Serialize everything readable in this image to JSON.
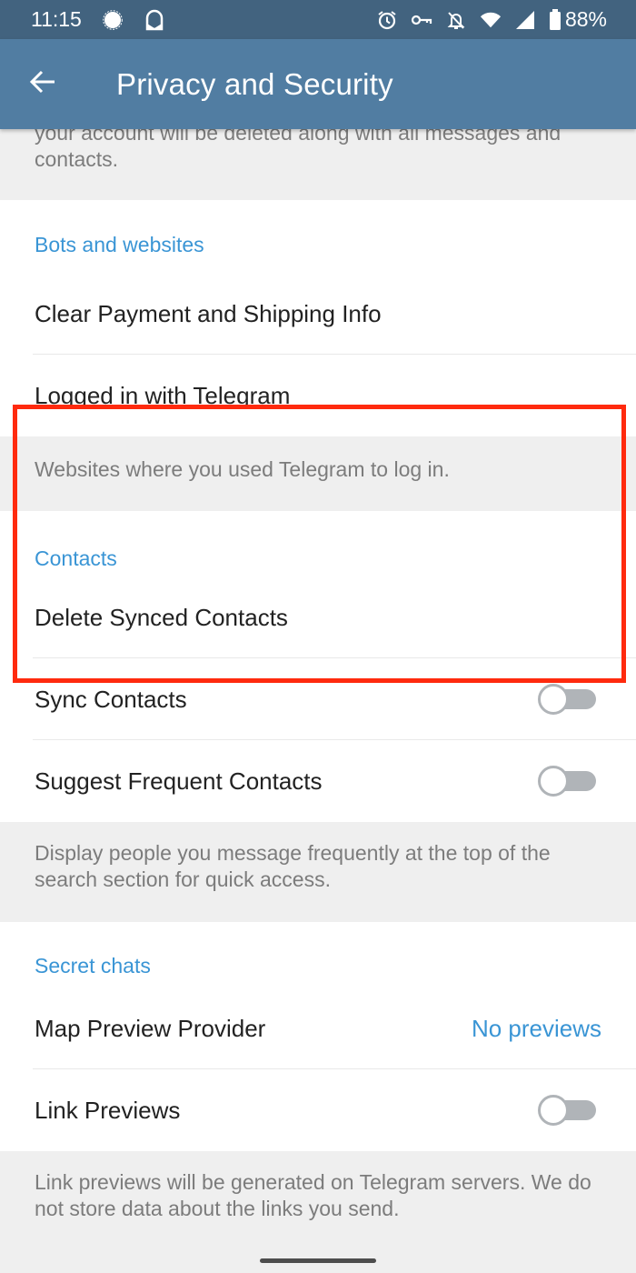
{
  "status_bar": {
    "time": "11:15",
    "left_icons": [
      "signal-messenger-icon",
      "protonmail-icon"
    ],
    "right_icons": [
      "alarm-icon",
      "vpn-key-icon",
      "notifications-off-icon",
      "wifi-icon",
      "cellular-signal-icon",
      "battery-icon"
    ],
    "battery": "88%"
  },
  "app_bar": {
    "back_icon": "arrow-back-icon",
    "title": "Privacy and Security"
  },
  "top_info": {
    "text_line1": "your account will be deleted along with all messages and",
    "text_line2": "contacts."
  },
  "sections": {
    "bots": {
      "header": "Bots and websites",
      "items": [
        {
          "label": "Clear Payment and Shipping Info"
        },
        {
          "label": "Logged in with Telegram"
        }
      ],
      "info": "Websites where you used Telegram to log in."
    },
    "contacts": {
      "header": "Contacts",
      "items": [
        {
          "label": "Delete Synced Contacts"
        },
        {
          "label": "Sync Contacts",
          "toggle": false
        },
        {
          "label": "Suggest Frequent Contacts",
          "toggle": false
        }
      ],
      "info": "Display people you message frequently at the top of the search section for quick access."
    },
    "secret": {
      "header": "Secret chats",
      "items": [
        {
          "label": "Map Preview Provider",
          "value": "No previews"
        },
        {
          "label": "Link Previews",
          "toggle": false
        }
      ],
      "info": "Link previews will be generated on Telegram servers. We do not store data about the links you send."
    }
  },
  "colors": {
    "status_bar": "#42637f",
    "app_bar": "#517da2",
    "accent": "#3a95d5",
    "highlight": "#ff2a0e",
    "toggle_off": "#b0b4b8"
  }
}
